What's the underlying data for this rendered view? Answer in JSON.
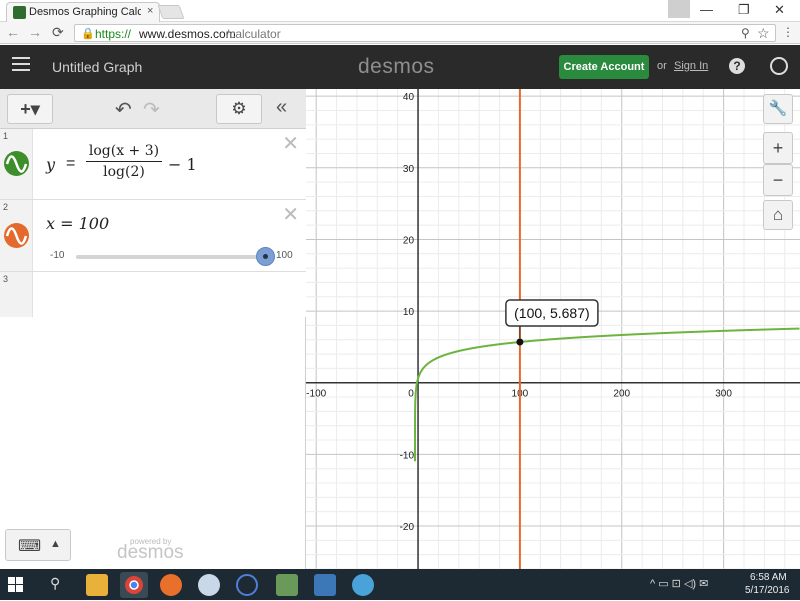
{
  "browser": {
    "tab_title": "Desmos Graphing Calculator",
    "tab_close": "×",
    "url_scheme": "https://",
    "url_host": "www.desmos.com",
    "url_path": "/calculator",
    "back": "←",
    "forward": "→",
    "reload": "⟳",
    "lock": "🔒",
    "zoom": "⚲",
    "star": "☆",
    "menu": "⋮",
    "minimize": "—",
    "restore": "❐",
    "close": "✕"
  },
  "header": {
    "graph_title": "Untitled Graph",
    "logo": "desmos",
    "create_account": "Create Account",
    "or": "or",
    "sign_in": "Sign In",
    "help": "?"
  },
  "toolbar": {
    "add": "+▾",
    "undo": "↶",
    "redo": "↷",
    "settings": "⚙",
    "collapse": "«"
  },
  "expressions": [
    {
      "index": "1",
      "color": "#3e8f2b",
      "lhs": "y",
      "eq": "=",
      "numerator": "log(x + 3)",
      "denominator": "log(2)",
      "tail": "− 1"
    },
    {
      "index": "2",
      "color": "#e36a2c",
      "text": "x = 100",
      "slider_min": "-10",
      "slider_max": "100",
      "slider_value": 100
    },
    {
      "index": "3"
    }
  ],
  "keyboard": {
    "icon": "⌨",
    "arrow": "▲"
  },
  "powered": {
    "top": "powered by",
    "brand": "desmos"
  },
  "graph_tools": {
    "wrench": "🔧",
    "zoom_in": "+",
    "zoom_out": "−",
    "home": "⌂"
  },
  "point_label": "(100, 5.687)",
  "chart_data": {
    "type": "line",
    "xlim": [
      -110,
      375
    ],
    "ylim": [
      -26,
      41
    ],
    "grid": true,
    "x_ticks": [
      "-100",
      "0",
      "100",
      "200",
      "300"
    ],
    "y_ticks": [
      "40",
      "30",
      "20",
      "10",
      "-10",
      "-20"
    ],
    "series": [
      {
        "expression": "y = log(x+3)/log(2) - 1",
        "color": "#6db33f",
        "kind": "function"
      },
      {
        "expression": "x = 100",
        "color": "#e36a2c",
        "kind": "vertical",
        "x": 100
      }
    ],
    "highlighted_point": {
      "x": 100,
      "y": 5.687
    }
  },
  "taskbar": {
    "time": "6:58 AM",
    "date": "5/17/2016",
    "tray": "^ ▭ ⊡ ◁) ✉"
  }
}
